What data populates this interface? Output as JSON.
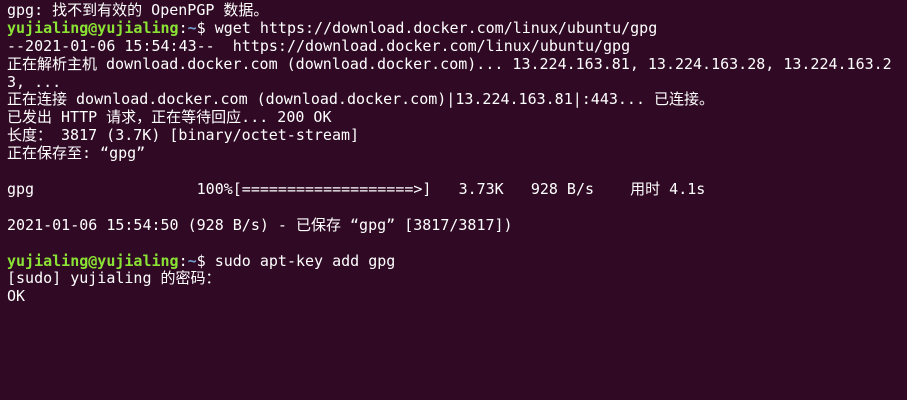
{
  "terminal": {
    "user_host": "yujialing@yujialing",
    "path": "~",
    "prompt_symbol": "$ ",
    "colors": {
      "background": "#300a24",
      "text": "#ffffff",
      "user": "#8ae234",
      "path": "#729fcf"
    },
    "lines": {
      "l1": "gpg: 找不到有效的 OpenPGP 数据。",
      "cmd1": "wget https://download.docker.com/linux/ubuntu/gpg",
      "l3": "--2021-01-06 15:54:43--  https://download.docker.com/linux/ubuntu/gpg",
      "l4": "正在解析主机 download.docker.com (download.docker.com)... 13.224.163.81, 13.224.163.28, 13.224.163.23, ...",
      "l5": "正在连接 download.docker.com (download.docker.com)|13.224.163.81|:443... 已连接。",
      "l6": "已发出 HTTP 请求，正在等待回应... 200 OK",
      "l7": "长度： 3817 (3.7K) [binary/octet-stream]",
      "l8": "正在保存至: “gpg”",
      "progress_file": "gpg",
      "progress_bar": "100%[===================>]",
      "progress_size": "3.73K",
      "progress_speed": "928 B/s",
      "progress_time": "用时 4.1s",
      "l10": "2021-01-06 15:54:50 (928 B/s) - 已保存 “gpg” [3817/3817])",
      "cmd2": "sudo apt-key add gpg",
      "l12": "[sudo] yujialing 的密码：",
      "l13": "OK"
    }
  }
}
